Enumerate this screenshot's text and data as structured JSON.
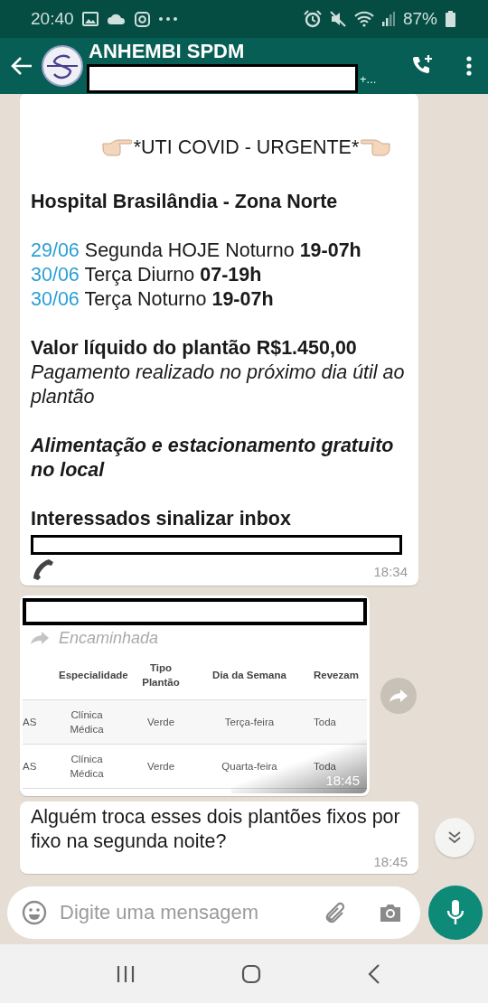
{
  "status_bar": {
    "time": "20:40",
    "battery": "87%"
  },
  "header": {
    "title": "ANHEMBI SPDM",
    "subtitle_redacted": true,
    "subtitle_suffix": "+..."
  },
  "messages": [
    {
      "kind": "post",
      "time": "18:34",
      "paragraphs": [
        {
          "lines": [
            {
              "kind": "heading",
              "text": "*UTI COVID - URGENTE*"
            }
          ]
        },
        {
          "lines": [
            {
              "kind": "bold",
              "text": "Hospital Brasilândia - Zona Norte"
            }
          ]
        },
        {
          "lines": [
            {
              "kind": "schedule",
              "date": "29/06",
              "text": "Segunda HOJE Noturno **19-07h**"
            },
            {
              "kind": "schedule",
              "date": "30/06",
              "text": "Terça Diurno **07-19h**"
            },
            {
              "kind": "schedule",
              "date": "30/06",
              "text": "Terça Noturno **19-07h**"
            }
          ]
        },
        {
          "lines": [
            {
              "kind": "bold",
              "text": "Valor líquido do plantão R$1.450,00"
            },
            {
              "kind": "italic",
              "text": "Pagamento realizado no próximo dia útil ao plantão"
            }
          ]
        },
        {
          "lines": [
            {
              "kind": "bold_italic",
              "text": "Alimentação e estacionamento gratuito no local"
            }
          ]
        },
        {
          "lines": [
            {
              "kind": "bold",
              "text": "Interessados sinalizar inbox"
            },
            {
              "kind": "redacted"
            },
            {
              "kind": "phone"
            }
          ]
        }
      ]
    },
    {
      "kind": "forwarded_image",
      "sender_redacted": true,
      "forwarded_label": "Encaminhada",
      "time": "18:45",
      "table": {
        "columns": [
          "Especialidade",
          "Tipo Plantão",
          "Dia da Semana",
          "Revezam"
        ],
        "rows": [
          {
            "column_1": "AS",
            "cells": [
              "Clínica Médica",
              "Verde",
              "Terça-feira",
              "Toda"
            ]
          },
          {
            "column_1": "AS",
            "cells": [
              "Clínica Médica",
              "Verde",
              "Quarta-feira",
              "Toda"
            ]
          }
        ]
      }
    },
    {
      "kind": "text",
      "text": "Alguém troca esses dois plantões fixos por fixo na segunda noite?",
      "time": "18:45"
    }
  ],
  "composer": {
    "placeholder": "Digite uma mensagem"
  }
}
